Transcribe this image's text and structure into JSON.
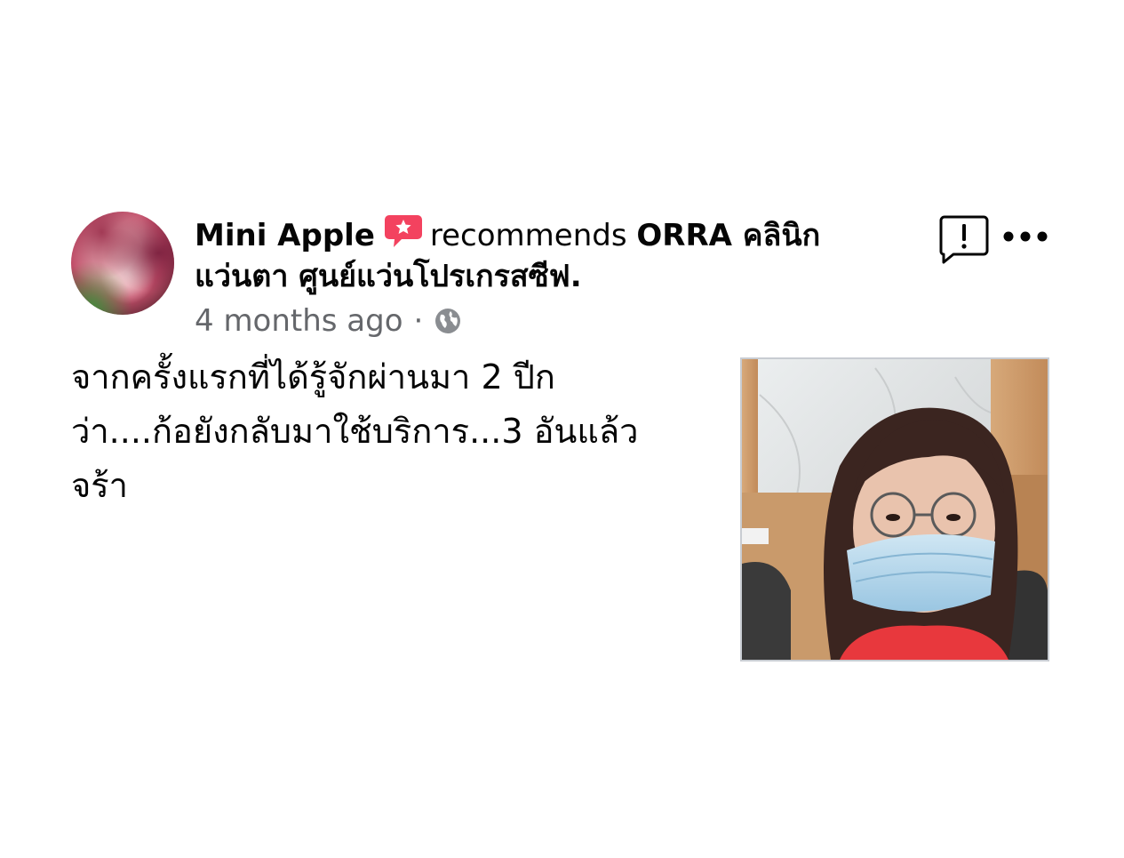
{
  "post": {
    "author": "Mini Apple",
    "verb": "recommends",
    "page_name_line1": "ORRA คลินิก",
    "page_name_line2": "แว่นตา ศูนย์แว่นโปรเกรสซีฟ",
    "page_name_suffix": ".",
    "timestamp": "4 months ago",
    "separator": "·",
    "privacy_icon": "globe-icon",
    "recommend_icon": "star-speech-bubble-icon",
    "recommend_color": "#f3425f",
    "body": "จากครั้งแรกที่ได้รู้จักผ่านมา 2 ปีก\nว่า....ก้อยังกลับมาใช้บริการ...3 อันแล้ว\nจร้า",
    "actions": {
      "report_icon": "report-icon",
      "more_icon": "more-options-icon"
    }
  }
}
